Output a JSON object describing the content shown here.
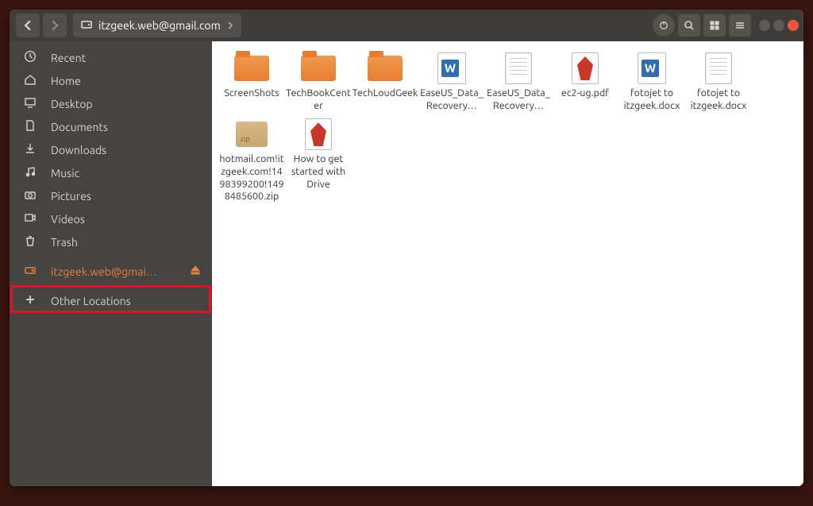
{
  "path_label": "itzgeek.web@gmail.com",
  "sidebar": [
    {
      "icon": "clock",
      "label": "Recent"
    },
    {
      "icon": "home",
      "label": "Home"
    },
    {
      "icon": "desktop",
      "label": "Desktop"
    },
    {
      "icon": "doc",
      "label": "Documents"
    },
    {
      "icon": "download",
      "label": "Downloads"
    },
    {
      "icon": "music",
      "label": "Music"
    },
    {
      "icon": "camera",
      "label": "Pictures"
    },
    {
      "icon": "video",
      "label": "Videos"
    },
    {
      "icon": "trash",
      "label": "Trash"
    },
    {
      "icon": "drive",
      "label": "itzgeek.web@gmai…",
      "active": true,
      "eject": true
    },
    {
      "icon": "plus",
      "label": "Other Locations"
    }
  ],
  "files": [
    {
      "type": "folder",
      "label": "ScreenShots"
    },
    {
      "type": "folder",
      "label": "TechBookCenter"
    },
    {
      "type": "folder",
      "label": "TechLoudGeek"
    },
    {
      "type": "word",
      "label": "EaseUS_Data_Recovery…"
    },
    {
      "type": "doc",
      "label": "EaseUS_Data_Recovery…"
    },
    {
      "type": "pdf",
      "label": "ec2-ug.pdf"
    },
    {
      "type": "word",
      "label": "fotojet to itzgeek.docx"
    },
    {
      "type": "doc",
      "label": "fotojet to itzgeek.docx"
    },
    {
      "type": "zip",
      "label": "hotmail.com!itzgeek.com!1498399200!1498485600.zip"
    },
    {
      "type": "pdf",
      "label": "How to get started with Drive"
    }
  ]
}
